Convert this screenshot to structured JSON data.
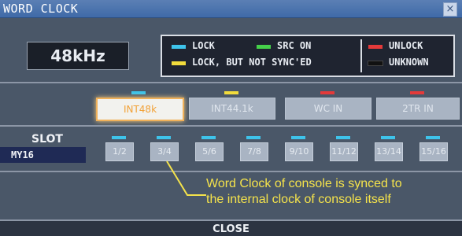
{
  "window": {
    "title": "WORD CLOCK",
    "close_glyph": "×"
  },
  "sample_rate": "48kHz",
  "legend": {
    "lock": "LOCK",
    "src_on": "SRC ON",
    "lock_not_synced": "LOCK, BUT NOT SYNC'ED",
    "unlock": "UNLOCK",
    "unknown": "UNKNOWN",
    "colors": {
      "lock": "#3ec3ea",
      "src_on": "#45d04a",
      "lock_not_synced": "#f2dc3c",
      "unlock": "#e43a3a",
      "unknown": "#111111"
    }
  },
  "sources": [
    {
      "label": "INT48k",
      "indicator": "#3ec3ea",
      "selected": true
    },
    {
      "label": "INT44.1k",
      "indicator": "#f2dc3c",
      "selected": false
    },
    {
      "label": "WC IN",
      "indicator": "#e43a3a",
      "selected": false
    },
    {
      "label": "2TR IN",
      "indicator": "#e43a3a",
      "selected": false
    }
  ],
  "slot": {
    "label": "SLOT",
    "card": "MY16",
    "buttons": [
      "1/2",
      "3/4",
      "5/6",
      "7/8",
      "9/10",
      "11/12",
      "13/14",
      "15/16"
    ],
    "indicator": "#3ec3ea"
  },
  "annotation": {
    "line1": "Word Clock of console is synced to",
    "line2": "the internal clock of console itself",
    "color": "#f5e34b"
  },
  "close_label": "CLOSE"
}
